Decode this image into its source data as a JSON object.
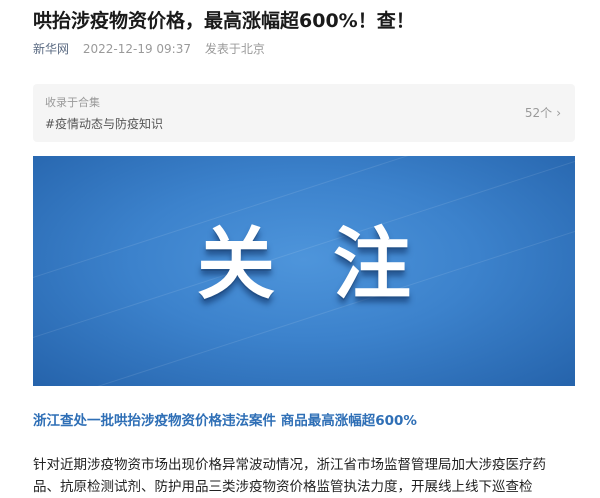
{
  "article": {
    "title": "哄抬涉疫物资价格，最高涨幅超600%！查！",
    "source": "新华网",
    "datetime": "2022-12-19 09:37",
    "location": "发表于北京"
  },
  "collection": {
    "label": "收录于合集",
    "tag": "#疫情动态与防疫知识",
    "count": "52个",
    "chevron": "›"
  },
  "banner": {
    "text": "关注",
    "colors": {
      "top": "#4e95db",
      "bottom": "#2563ab",
      "text": "#ffffff"
    }
  },
  "subheading": "浙江查处一批哄抬涉疫物资价格违法案件 商品最高涨幅超600%",
  "body_lines": [
    "针对近期涉疫物资市场出现价格异常波动情况，浙江省市场监督管理局加大涉疫医疗药",
    "品、抗原检测试剂、防护用品三类涉疫物资价格监管执法力度，开展线上线下巡查检"
  ],
  "colors": {
    "accent": "#2f6fb6",
    "meta": "#9a9a9a",
    "source": "#5a6a82"
  }
}
